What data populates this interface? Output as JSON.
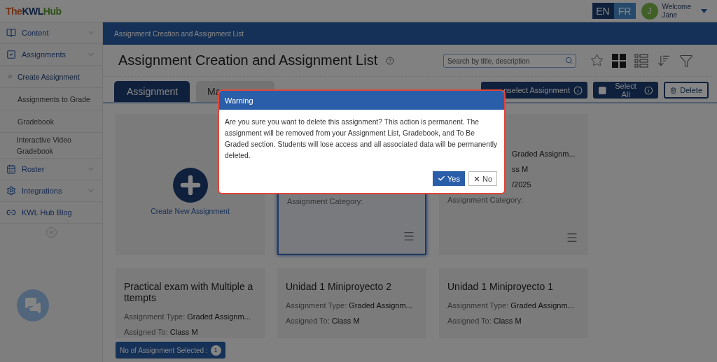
{
  "header": {
    "logo": [
      "The",
      "KWL",
      "Hub"
    ],
    "languages": [
      {
        "label": "EN",
        "selected": true
      },
      {
        "label": "FR",
        "selected": false
      }
    ],
    "user": {
      "initial": "J",
      "greeting": "Welcome",
      "name": "Jane"
    }
  },
  "sidebar": {
    "items": [
      {
        "label": "Content",
        "expandable": true
      },
      {
        "label": "Assignments",
        "expandable": true,
        "children": [
          {
            "label": "Create Assignment",
            "selected": true
          },
          {
            "label": "Assignments to Grade",
            "selected": false
          },
          {
            "label": "Gradebook",
            "selected": false
          },
          {
            "label": "Interactive Video Gradebook",
            "selected": false
          }
        ]
      },
      {
        "label": "Roster",
        "expandable": true
      },
      {
        "label": "Integrations",
        "expandable": true
      },
      {
        "label": "KWL Hub Blog",
        "expandable": false
      }
    ]
  },
  "breadcrumb": "Assignment Creation and Assignment List",
  "page_title": "Assignment Creation and Assignment List",
  "search": {
    "placeholder": "Search by title, description"
  },
  "views": [
    {
      "kind": "grid",
      "selected": true
    },
    {
      "kind": "list",
      "selected": false
    }
  ],
  "tabs": [
    {
      "label": "Assignment",
      "selected": true
    },
    {
      "label": "Ma",
      "selected": false
    }
  ],
  "actions": [
    {
      "kind": "unselect",
      "label": "nselect Assignment"
    },
    {
      "kind": "select_all",
      "label": "Select All"
    },
    {
      "kind": "delete",
      "label": "Delete"
    }
  ],
  "cards": [
    {
      "kind": "create",
      "label": "Create New Assignment"
    },
    {
      "kind": "assignment",
      "selected": true,
      "fields": [
        {
          "label": "Assignment Category:"
        }
      ]
    },
    {
      "kind": "assignment",
      "selected": false,
      "fields": [
        {
          "value": "Graded Assignm..."
        },
        {
          "value": "ss M"
        },
        {
          "value": "/2025"
        },
        {
          "label": "Assignment Category:"
        }
      ]
    },
    {
      "kind": "assignment",
      "selected": false,
      "title": "Practical exam with Multiple attempts",
      "fields": [
        {
          "label": "Assignment Type:",
          "value": "Graded Assignm..."
        },
        {
          "label": "Assigned To:",
          "value": "Class M"
        }
      ]
    },
    {
      "kind": "assignment",
      "selected": false,
      "title": "Unidad 1 Miniproyecto 2",
      "fields": [
        {
          "label": "Assignment Type:",
          "value": "Graded Assignm..."
        },
        {
          "label": "Assigned To:",
          "value": "Class M"
        }
      ]
    },
    {
      "kind": "assignment",
      "selected": false,
      "title": "Unidad 1 Miniproyecto 1",
      "fields": [
        {
          "label": "Assignment Type:",
          "value": "Graded Assignm..."
        },
        {
          "label": "Assigned To:",
          "value": "Class M"
        }
      ]
    }
  ],
  "selection_count": {
    "label": "No of Assignment Selected :",
    "count": "1"
  },
  "modal": {
    "title": "Warning",
    "message": "Are you sure you want to delete this assignment? This action is permanent. The assignment will be removed from your Assignment List, Gradebook, and To Be Graded section. Students will lose access and all associated data will be permanently deleted.",
    "buttons": [
      {
        "kind": "yes",
        "label": "Yes"
      },
      {
        "kind": "no",
        "label": "No"
      }
    ]
  }
}
